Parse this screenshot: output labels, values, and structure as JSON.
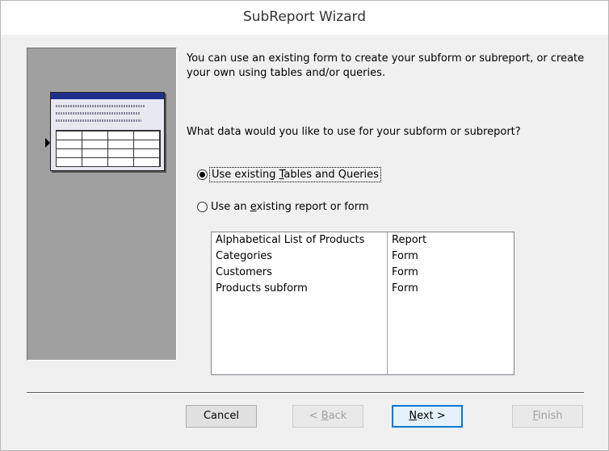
{
  "window": {
    "title": "SubReport Wizard"
  },
  "intro": "You can use an existing form to create your subform or subreport, or create your own using tables and/or queries.",
  "question": "What data would you like to use for your subform or subreport?",
  "options": [
    {
      "pre": "Use existing ",
      "key": "T",
      "post": "ables and Queries",
      "checked": true
    },
    {
      "pre": "Use an ",
      "key": "e",
      "post": "xisting report or form",
      "checked": false
    }
  ],
  "list_items": [
    {
      "name": "Alphabetical List of Products",
      "type": "Report"
    },
    {
      "name": "Categories",
      "type": "Form"
    },
    {
      "name": "Customers",
      "type": "Form"
    },
    {
      "name": "Products subform",
      "type": "Form"
    }
  ],
  "buttons": {
    "cancel": "Cancel",
    "back": {
      "pre": "< ",
      "key": "B",
      "post": "ack"
    },
    "next": {
      "pre": "",
      "key": "N",
      "post": "ext >"
    },
    "finish": {
      "pre": "",
      "key": "F",
      "post": "inish"
    }
  }
}
